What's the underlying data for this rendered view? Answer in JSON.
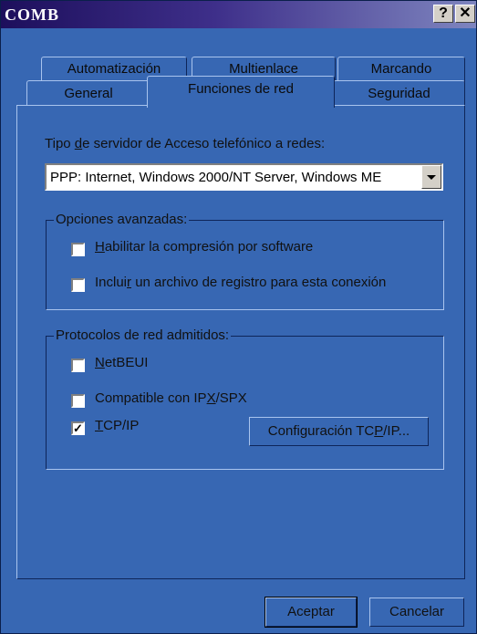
{
  "window": {
    "title": "COMB",
    "help_button": "?",
    "close_button": "✕"
  },
  "tabs": {
    "row_back": [
      {
        "label": "Automatización"
      },
      {
        "label": "Multienlace"
      },
      {
        "label": "Marcando"
      }
    ],
    "row_front": [
      {
        "label": "General"
      },
      {
        "label": "Funciones de red",
        "selected": true
      },
      {
        "label": "Seguridad"
      }
    ]
  },
  "server_type": {
    "label_pre": "Tipo ",
    "label_accel": "d",
    "label_post": "e servidor de Acceso telefónico a redes:",
    "selected_value": "PPP: Internet, Windows 2000/NT Server, Windows ME"
  },
  "advanced": {
    "legend": "Opciones avanzadas:",
    "compression": {
      "accel": "H",
      "rest": "abilitar la compresión por software",
      "checked": false
    },
    "log": {
      "pre": "Inclui",
      "accel": "r",
      "post": " un archivo de registro para esta conexión",
      "checked": false
    }
  },
  "protocols": {
    "legend": "Protocolos de red admitidos:",
    "netbeui": {
      "accel": "N",
      "rest": "etBEUI",
      "checked": false
    },
    "ipx": {
      "pre": "Compatible con IP",
      "accel": "X",
      "post": "/SPX",
      "checked": false
    },
    "tcpip": {
      "accel": "T",
      "rest": "CP/IP",
      "checked": true
    },
    "config_button": {
      "pre": "Configuración TC",
      "accel": "P",
      "post": "/IP..."
    }
  },
  "buttons": {
    "ok": "Aceptar",
    "cancel": "Cancelar"
  },
  "check_glyph": "✓"
}
